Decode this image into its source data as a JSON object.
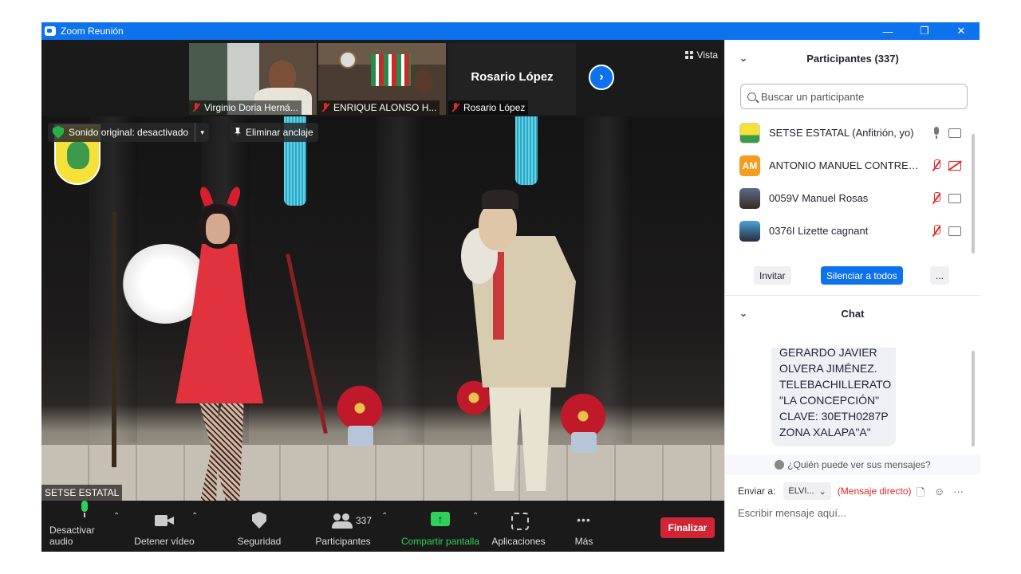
{
  "window": {
    "title": "Zoom Reunión",
    "controls": [
      "—",
      "❐",
      "✕"
    ]
  },
  "gallery": {
    "tiles": [
      {
        "name": "Virginio Doria Herná..."
      },
      {
        "name": "ENRIQUE ALONSO H..."
      },
      {
        "name": "Rosario López"
      }
    ],
    "name_only_tile": "Rosario López",
    "next_arrow": "›",
    "view_label": "Vista"
  },
  "video": {
    "sound_label": "Sonido original: desactivado",
    "sound_caret": "▾",
    "unpin_label": "Eliminar anclaje",
    "speaker_name": "SETSE ESTATAL"
  },
  "toolbar": {
    "items": [
      {
        "label": "Desactivar audio",
        "icon": "microphone-icon"
      },
      {
        "label": "Detener vídeo",
        "icon": "video-camera-icon"
      },
      {
        "label": "Seguridad",
        "icon": "shield-icon"
      },
      {
        "label": "Participantes",
        "icon": "participants-icon",
        "count": "337"
      },
      {
        "label": "Compartir pantalla",
        "icon": "share-screen-icon"
      },
      {
        "label": "Aplicaciones",
        "icon": "apps-icon"
      },
      {
        "label": "Más",
        "icon": "more-icon"
      }
    ],
    "caret": "⌃",
    "end_label": "Finalizar",
    "colors": {
      "share": "#2fd05a",
      "end": "#d02535",
      "mic": "#2fd05a"
    }
  },
  "participants": {
    "header": "Participantes (337)",
    "chevron": "⌄",
    "search_placeholder": "Buscar un participante",
    "rows": [
      {
        "name": "SETSE ESTATAL (Anfitrión, yo)",
        "avatar": "",
        "mic": "on",
        "cam": "on"
      },
      {
        "name": "ANTONIO MANUEL CONTRER...",
        "avatar": "AM",
        "mic": "muted",
        "cam": "off"
      },
      {
        "name": "0059V Manuel Rosas",
        "avatar": "",
        "mic": "muted",
        "cam": "on"
      },
      {
        "name": "0376I Lizette cagnant",
        "avatar": "",
        "mic": "muted",
        "cam": "on"
      }
    ],
    "invite_label": "Invitar",
    "mute_all_label": "Silenciar a todos",
    "more_label": "..."
  },
  "chat": {
    "header": "Chat",
    "chevron": "⌄",
    "message_lines": [
      "GERARDO JAVIER",
      "OLVERA JIMÉNEZ.",
      "TELEBACHILLERATO",
      "\"LA CONCEPCIÓN\"",
      "CLAVE: 30ETH0287P",
      "ZONA XALAPA\"A\""
    ],
    "who_can_see": "¿Quién puede ver sus mensajes?",
    "send_to_label": "Enviar a:",
    "recipient": "ELVI...",
    "recipient_caret": "⌄",
    "direct_label": "(Mensaje directo)",
    "file_icon": "🗋",
    "emoji_icon": "☺",
    "more_icon": "···",
    "input_placeholder": "Escribir mensaje aquí..."
  }
}
